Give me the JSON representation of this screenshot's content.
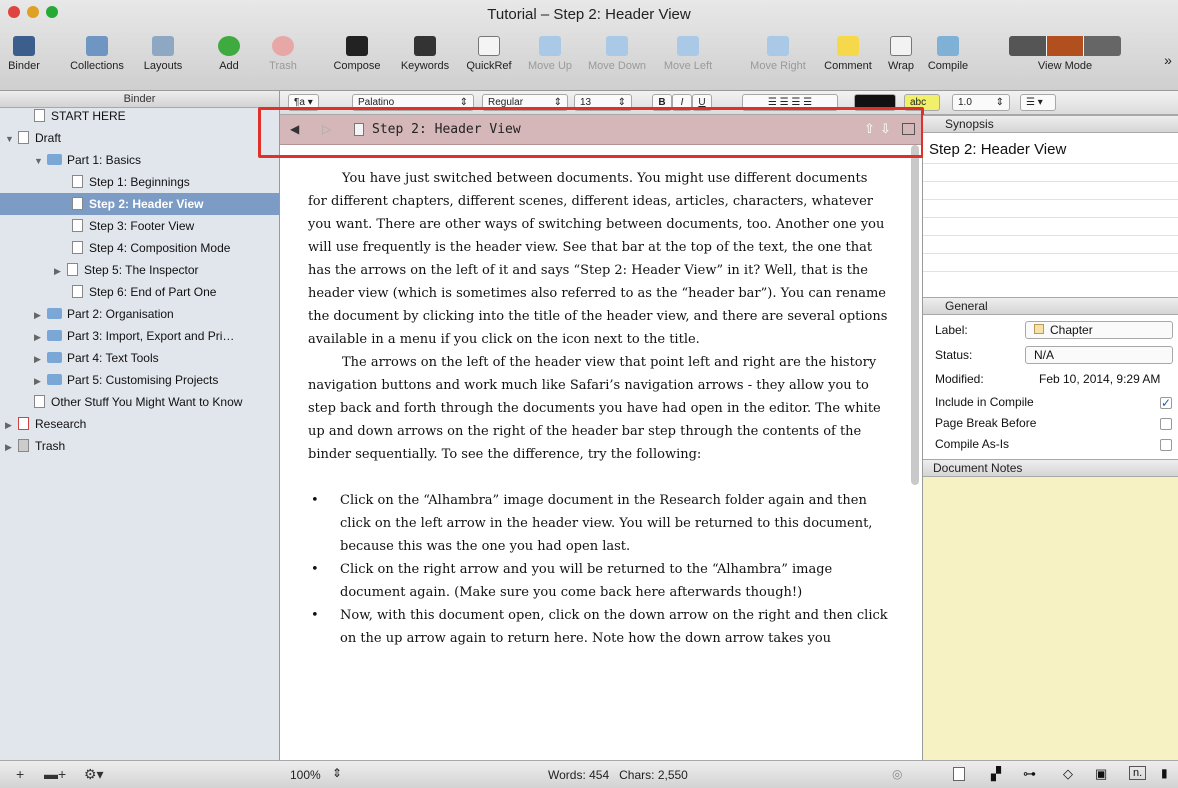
{
  "window": {
    "title": "Tutorial – Step 2: Header View"
  },
  "toolbar": {
    "binder": "Binder",
    "collections": "Collections",
    "layouts": "Layouts",
    "add": "Add",
    "trash": "Trash",
    "compose": "Compose",
    "keywords": "Keywords",
    "quickref": "QuickRef",
    "move_up": "Move Up",
    "move_down": "Move Down",
    "move_left": "Move Left",
    "move_right": "Move Right",
    "comment": "Comment",
    "wrap": "Wrap",
    "compile": "Compile",
    "view_mode": "View Mode"
  },
  "format": {
    "font": "Palatino",
    "weight": "Regular",
    "size": "13",
    "line_spacing": "1.0",
    "highlight": "abc"
  },
  "binder": {
    "header": "Binder",
    "items": [
      {
        "label": "START HERE"
      },
      {
        "label": "Draft"
      },
      {
        "label": "Part 1: Basics"
      },
      {
        "label": "Step 1: Beginnings"
      },
      {
        "label": "Step 2: Header View"
      },
      {
        "label": "Step 3: Footer View"
      },
      {
        "label": "Step 4: Composition Mode"
      },
      {
        "label": "Step 5: The Inspector"
      },
      {
        "label": "Step 6: End of Part One"
      },
      {
        "label": "Part 2: Organisation"
      },
      {
        "label": "Part 3: Import, Export and Pri…"
      },
      {
        "label": "Part 4: Text Tools"
      },
      {
        "label": "Part 5: Customising Projects"
      },
      {
        "label": "Other Stuff You Might Want to Know"
      },
      {
        "label": "Research"
      },
      {
        "label": "Trash"
      }
    ]
  },
  "header_view": {
    "title": "Step 2: Header View"
  },
  "document": {
    "p1": "You have just switched between documents. You might use different documents for different chapters, different scenes, different ideas, articles, characters, whatever you want. There are other ways of switching between documents, too. Another one you will use frequently is the header view. See that bar at the top of the text, the one that has the arrows on the left of it and says “Step 2: Header View” in it? Well, that is the header view (which is sometimes also referred to as the “header bar”). You can rename the document by clicking into the title of the header view, and there are several options available in a menu if you click on the icon next to the title.",
    "p2": "The arrows on the left of the header view that point left and right are the history navigation buttons and work much like Safari’s navigation arrows - they allow you to step back and forth through the documents you have had open in the editor. The white up and down arrows on the right of the header bar step through the contents of the binder sequentially. To see the difference, try the following:",
    "bullets": [
      "Click on the “Alhambra” image document in the Research folder again and then click on the left arrow in the header view. You will be returned to this document, because this was the one you had open last.",
      "Click on the right arrow and you will be returned to the “Alhambra” image document again. (Make sure you come back here afterwards though!)",
      "Now, with this document open, click on the down arrow on the right and then click on the up arrow again to return here. Note how the down arrow takes you"
    ]
  },
  "footer": {
    "zoom": "100%",
    "counts": "Words: 454   Chars: 2,550"
  },
  "inspector": {
    "synopsis_header": "Synopsis",
    "synopsis_title": "Step 2: Header View",
    "general_header": "General",
    "label_key": "Label:",
    "label_value": "Chapter",
    "status_key": "Status:",
    "status_value": "N/A",
    "modified_key": "Modified:",
    "modified_value": "Feb 10, 2014, 9:29 AM",
    "include_compile": "Include in Compile",
    "page_break": "Page Break Before",
    "compile_as_is": "Compile As-Is",
    "notes_header": "Document Notes"
  },
  "colors": {
    "header_bar": "#d6b7b9",
    "selection": "#7c9cc6",
    "highlight_box": "#e0302a",
    "notes": "#f6f2c3"
  }
}
